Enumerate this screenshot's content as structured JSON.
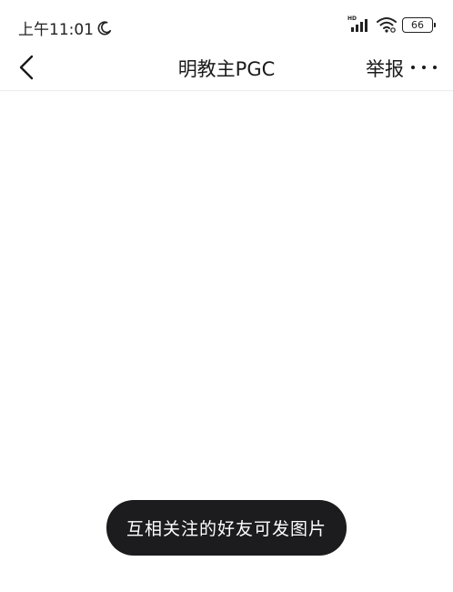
{
  "status_bar": {
    "time": "上午11:01",
    "signal_label": "HD",
    "battery_level": "66"
  },
  "nav": {
    "title": "明教主PGC",
    "report_label": "举报"
  },
  "toast": {
    "message": "互相关注的好友可发图片"
  }
}
